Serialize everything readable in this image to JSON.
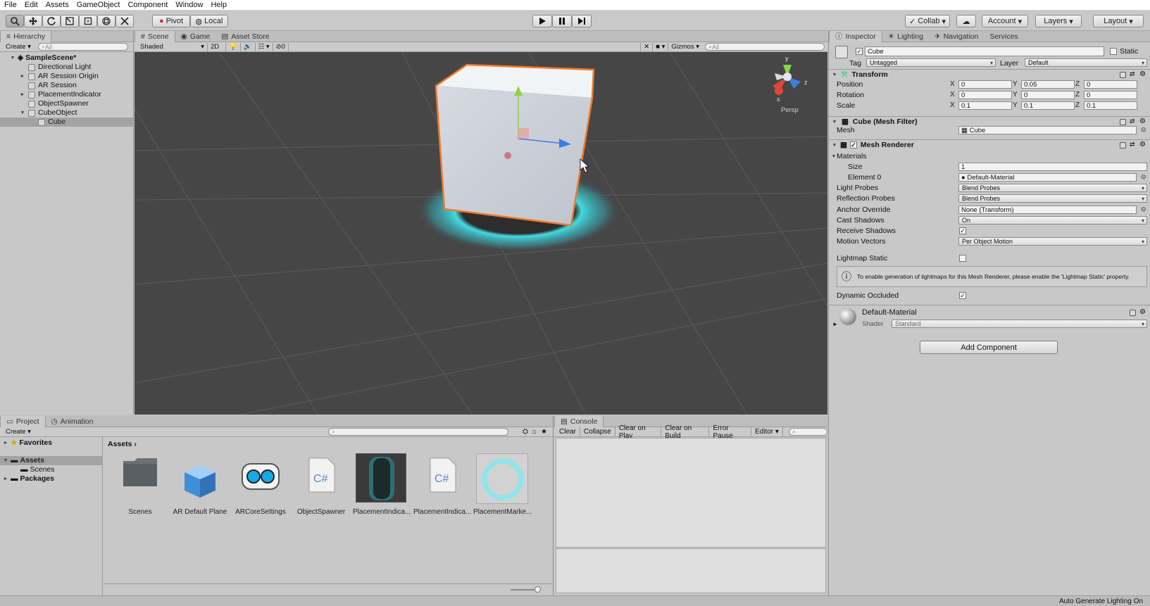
{
  "menu": [
    "File",
    "Edit",
    "Assets",
    "GameObject",
    "Component",
    "Window",
    "Help"
  ],
  "toolbar": {
    "pivot": "Pivot",
    "local": "Local",
    "collab": "Collab",
    "account": "Account",
    "layers": "Layers",
    "layout": "Layout"
  },
  "hierarchy": {
    "tab": "Hierarchy",
    "create": "Create",
    "search_placeholder": "All",
    "scene": "SampleScene*",
    "items": [
      {
        "label": "Directional Light",
        "indent": 1,
        "arrow": ""
      },
      {
        "label": "AR Session Origin",
        "indent": 1,
        "arrow": "►"
      },
      {
        "label": "AR Session",
        "indent": 1,
        "arrow": ""
      },
      {
        "label": "PlacementIndicator",
        "indent": 1,
        "arrow": "►"
      },
      {
        "label": "ObjectSpawner",
        "indent": 1,
        "arrow": ""
      },
      {
        "label": "CubeObject",
        "indent": 1,
        "arrow": "▼"
      },
      {
        "label": "Cube",
        "indent": 2,
        "arrow": "",
        "selected": true
      }
    ]
  },
  "scene_view": {
    "tabs": [
      "Scene",
      "Game",
      "Asset Store"
    ],
    "shading": "Shaded",
    "mode_2d": "2D",
    "fx_count": "0",
    "gizmos": "Gizmos",
    "search_placeholder": "All",
    "persp": "Persp",
    "axis_y": "y",
    "axis_z": "z",
    "axis_x": "x"
  },
  "inspector": {
    "tabs": [
      "Inspector",
      "Lighting",
      "Navigation",
      "Services"
    ],
    "object_name": "Cube",
    "static_label": "Static",
    "tag_label": "Tag",
    "tag_value": "Untagged",
    "layer_label": "Layer",
    "layer_value": "Default",
    "transform": {
      "title": "Transform",
      "position_label": "Position",
      "rotation_label": "Rotation",
      "scale_label": "Scale",
      "position": [
        "0",
        "0.05",
        "0"
      ],
      "rotation": [
        "0",
        "0",
        "0"
      ],
      "scale": [
        "0.1",
        "0.1",
        "0.1"
      ]
    },
    "mesh_filter": {
      "title": "Cube (Mesh Filter)",
      "mesh_label": "Mesh",
      "mesh_value": "Cube"
    },
    "mesh_renderer": {
      "title": "Mesh Renderer",
      "materials_label": "Materials",
      "size_label": "Size",
      "size_value": "1",
      "element0_label": "Element 0",
      "element0_value": "Default-Material",
      "light_probes_label": "Light Probes",
      "light_probes_value": "Blend Probes",
      "reflection_probes_label": "Reflection Probes",
      "reflection_probes_value": "Blend Probes",
      "anchor_override_label": "Anchor Override",
      "anchor_override_value": "None (Transform)",
      "cast_shadows_label": "Cast Shadows",
      "cast_shadows_value": "On",
      "receive_shadows_label": "Receive Shadows",
      "motion_vectors_label": "Motion Vectors",
      "motion_vectors_value": "Per Object Motion",
      "lightmap_static_label": "Lightmap Static",
      "lightmap_info": "To enable generation of lightmaps for this Mesh Renderer, please enable the 'Lightmap Static' property.",
      "dynamic_occluded_label": "Dynamic Occluded"
    },
    "material": {
      "name": "Default-Material",
      "shader_label": "Shader",
      "shader_value": "Standard"
    },
    "add_component": "Add Component"
  },
  "project": {
    "tabs": [
      "Project",
      "Animation"
    ],
    "create": "Create",
    "favorites": "Favorites",
    "assets": "Assets",
    "scenes": "Scenes",
    "packages": "Packages",
    "breadcrumb": "Assets",
    "items": [
      "Scenes",
      "AR Default Plane",
      "ARCoreSettings",
      "ObjectSpawner",
      "PlacementIndica...",
      "PlacementIndica...",
      "PlacementMarke..."
    ]
  },
  "console": {
    "tab": "Console",
    "buttons": [
      "Clear",
      "Collapse",
      "Clear on Play",
      "Clear on Build",
      "Error Pause",
      "Editor"
    ]
  },
  "status": "Auto Generate Lighting On"
}
